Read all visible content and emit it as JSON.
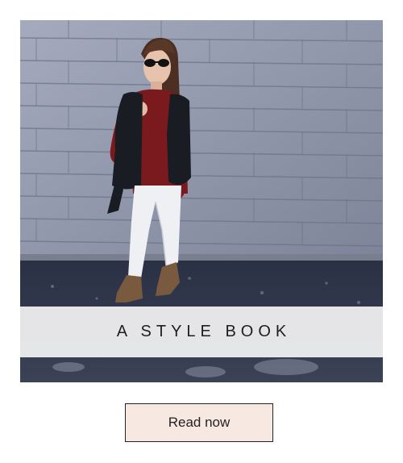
{
  "card": {
    "title": "A STYLE BOOK",
    "button_label": "Read now"
  },
  "colors": {
    "banner_background": "#f4f4f4",
    "button_background": "#f8e8e2",
    "button_border": "#222222",
    "text": "#1e1e1e"
  },
  "image": {
    "subject": "woman-in-fur-vest-and-white-jeans-photo"
  }
}
